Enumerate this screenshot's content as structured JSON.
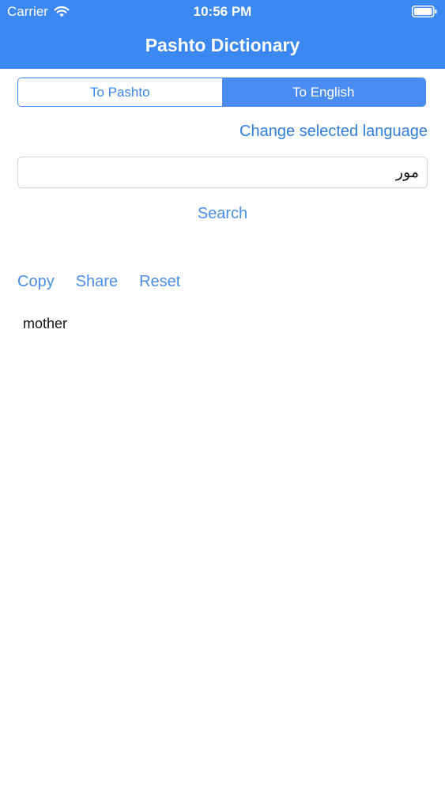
{
  "status_bar": {
    "carrier": "Carrier",
    "time": "10:56 PM"
  },
  "header": {
    "title": "Pashto Dictionary"
  },
  "language_toggle": {
    "options": [
      "To Pashto",
      "To English"
    ],
    "selected": "To English"
  },
  "change_language_label": "Change selected language",
  "search": {
    "value": "مور",
    "button_label": "Search"
  },
  "actions": {
    "copy": "Copy",
    "share": "Share",
    "reset": "Reset"
  },
  "result": {
    "text": "mother"
  },
  "colors": {
    "accent": "#3b88f0",
    "link": "#4a8ee8"
  },
  "icons": {
    "wifi": "wifi-icon",
    "battery": "battery-icon"
  }
}
